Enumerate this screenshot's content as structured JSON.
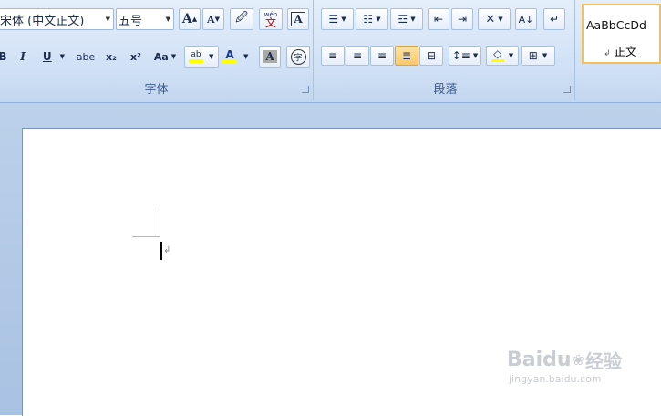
{
  "font_group": {
    "font_name": "宋体 (中文正文)",
    "font_size": "五号",
    "label": "字体",
    "grow_font_icon": "A",
    "shrink_font_icon": "A",
    "bold": "B",
    "italic": "I",
    "underline": "U",
    "strikethrough": "abe",
    "subscript": "x₂",
    "superscript": "x²",
    "change_case": "Aa",
    "highlight": "ab",
    "font_color": "A",
    "char_shading": "A",
    "enclosed_char": "字",
    "phonetic": "wén",
    "phonetic_char": "文",
    "char_border": "A"
  },
  "paragraph_group": {
    "label": "段落"
  },
  "styles_group": {
    "preview_text": "AaBbCcDd",
    "style_name": "正文",
    "para_mark": "↲"
  },
  "document": {
    "para_mark": "↲"
  },
  "watermark": {
    "brand": "Baidu",
    "brand_cn": "经验",
    "url": "jingyan.baidu.com"
  },
  "colors": {
    "ribbon": "#cfe0f5",
    "highlight_yellow": "#ffff00",
    "font_color_red": "#ff0000",
    "active_orange": "#f9c86b"
  }
}
